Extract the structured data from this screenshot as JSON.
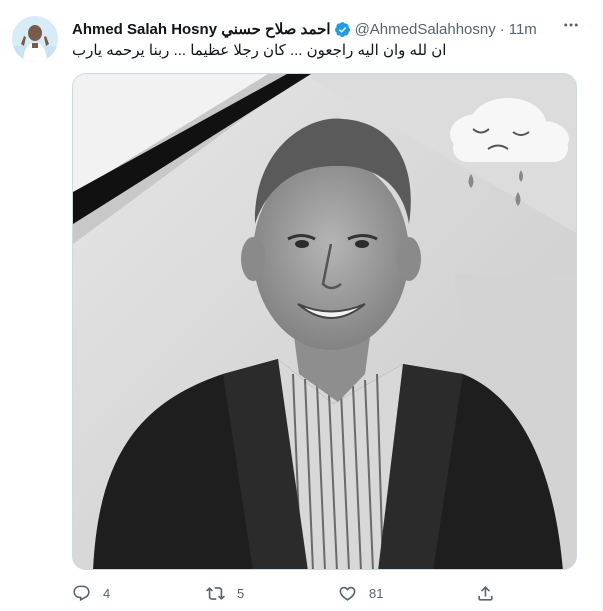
{
  "tweet": {
    "display_name": "Ahmed Salah Hosny احمد صلاح حسني",
    "handle": "@AhmedSalahhosny",
    "separator": "·",
    "time": "11m",
    "text": "ان لله وان اليه راجعون ... كان رجلا عظيما ... ربنا يرحمه يارب",
    "verified": true
  },
  "actions": {
    "reply_count": "4",
    "retweet_count": "5",
    "like_count": "81"
  },
  "icons": {
    "more": "more-horizontal-icon",
    "verified": "verified-badge-icon",
    "reply": "reply-icon",
    "retweet": "retweet-icon",
    "like": "heart-icon",
    "share": "share-icon"
  },
  "colors": {
    "verified_blue": "#1d9bf0",
    "text_primary": "#0f1419",
    "text_secondary": "#536471",
    "border": "#cfd9de"
  }
}
